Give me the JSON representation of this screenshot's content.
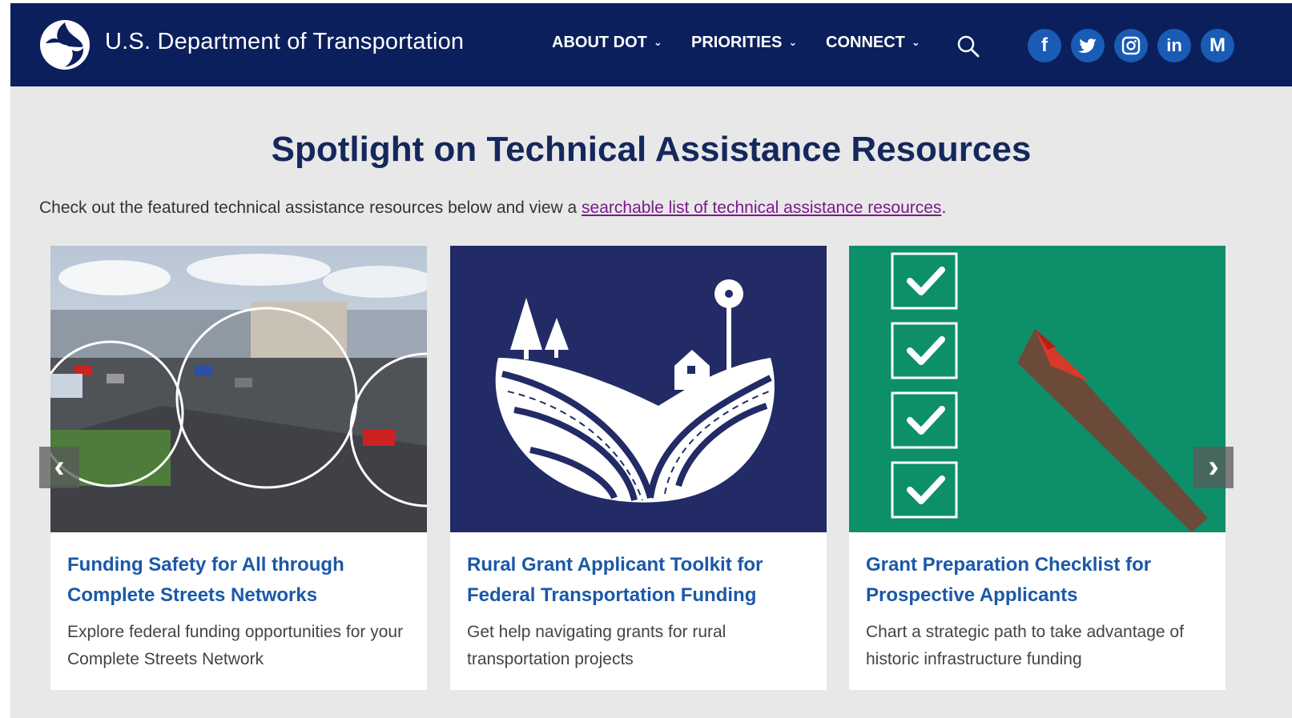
{
  "header": {
    "site_title": "U.S. Department of Transportation",
    "nav": [
      {
        "label": "ABOUT DOT"
      },
      {
        "label": "PRIORITIES"
      },
      {
        "label": "CONNECT"
      }
    ],
    "social": [
      {
        "name": "facebook-icon",
        "glyph": "f"
      },
      {
        "name": "twitter-icon",
        "glyph": ""
      },
      {
        "name": "instagram-icon",
        "glyph": ""
      },
      {
        "name": "linkedin-icon",
        "glyph": "in"
      },
      {
        "name": "medium-icon",
        "glyph": "M"
      }
    ]
  },
  "main": {
    "title": "Spotlight on Technical Assistance Resources",
    "intro_text": "Check out the featured technical assistance resources below and view a ",
    "intro_link": "searchable list of technical assistance resources",
    "intro_end": ".",
    "cards": [
      {
        "title": "Funding Safety for All through Complete Streets Networks",
        "description": "Explore federal funding opportunities for your Complete Streets Network"
      },
      {
        "title": "Rural Grant Applicant Toolkit for Federal Transportation Funding",
        "description": "Get help navigating grants for rural transportation projects"
      },
      {
        "title": "Grant Preparation Checklist for Prospective Applicants",
        "description": "Chart a strategic path to take advantage of historic infrastructure funding"
      }
    ]
  },
  "colors": {
    "header_bg": "#0b1f5c",
    "title": "#14285c",
    "card_link": "#1b58a8",
    "social_bg": "#1a5bb5",
    "rural_bg": "#222b66",
    "checklist_bg": "#0d8f6a"
  }
}
